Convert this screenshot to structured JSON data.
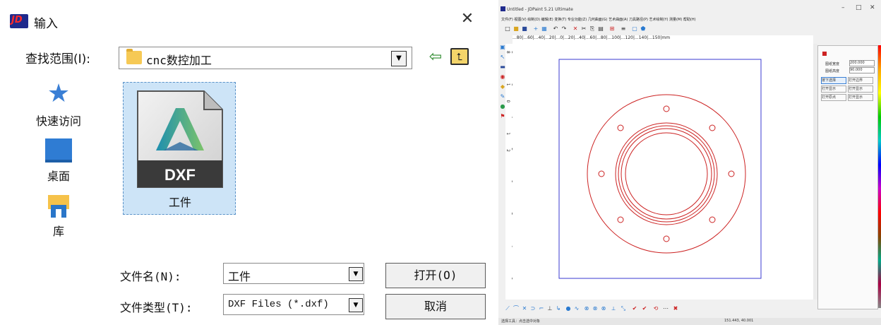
{
  "dialog": {
    "title": "输入",
    "logo_text": "JD",
    "close_glyph": "✕",
    "look_in_label": "查找范围(I):",
    "look_in_value": "cnc数控加工",
    "places": [
      {
        "label": "快速访问",
        "icon": "star-icon"
      },
      {
        "label": "桌面",
        "icon": "desktop-icon"
      },
      {
        "label": "库",
        "icon": "library-icon"
      }
    ],
    "file": {
      "name": "工件",
      "badge": "DXF"
    },
    "file_name_label": "文件名(N):",
    "file_name_value": "工件",
    "file_type_label": "文件类型(T):",
    "file_type_value": "DXF Files (*.dxf)",
    "open_label": "打开(O)",
    "cancel_label": "取消",
    "colors": {
      "selection": "#cde4f7",
      "accent": "#2f7cd3"
    }
  },
  "app": {
    "title": "Untitled - JDPaint 5.21 Ultimate",
    "window_controls": [
      "–",
      "□",
      "✕"
    ],
    "menu": "文件(F)  视图(V)  绘制(D)  编辑(E)  变换(T)  专业功能(Z)  几何曲面(G)  艺术曲面(A)  刀具路径(P)  艺术绘制(Y)  测量(M)  帮助(H)",
    "ruler_top": "...80|...60|...40|...20|...0|...20|...40|...60|...80|...100|...120|...140|...150|mm",
    "ruler_left": "8 6 4 2 0 2 4 6 8 10 12",
    "panel": {
      "rows": [
        {
          "label": "图纸宽度",
          "value": "200.000"
        },
        {
          "label": "图纸高度",
          "value": "90.000"
        }
      ],
      "buttons": [
        "按下选择",
        "打开边界",
        "打开显示",
        "打开显示",
        "打开原点",
        "打开显示"
      ]
    },
    "status_left": "选择工具：点击选中对象",
    "status_right": "151.443, 40.001",
    "drawing_color": "#cc2222",
    "frame_color": "#3a3ad0"
  }
}
